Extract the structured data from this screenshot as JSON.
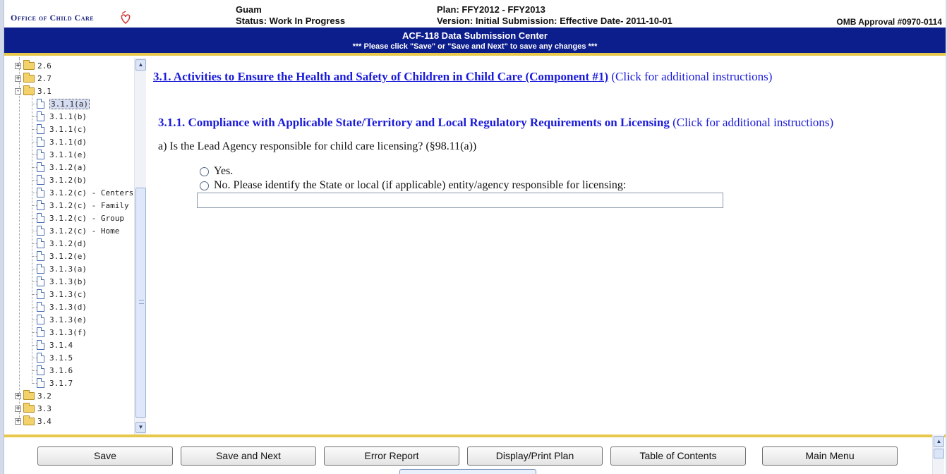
{
  "header": {
    "logo_text": "Office of Child Care",
    "state": "Guam",
    "status": "Status: Work In Progress",
    "plan": "Plan: FFY2012 - FFY2013",
    "version": "Version: Initial Submission: Effective Date- 2011-10-01",
    "omb": "OMB Approval #0970-0114"
  },
  "banner": {
    "title": "ACF-118 Data Submission Center",
    "subtitle": "*** Please click \"Save\" or \"Save and Next\" to save any changes ***"
  },
  "tree": {
    "items": [
      {
        "label": "2.6",
        "type": "folder",
        "expander": "+"
      },
      {
        "label": "2.7",
        "type": "folder",
        "expander": "+"
      },
      {
        "label": "3.1",
        "type": "folder",
        "expander": "-"
      },
      {
        "label": "3.1.1(a)",
        "type": "doc",
        "selected": true
      },
      {
        "label": "3.1.1(b)",
        "type": "doc"
      },
      {
        "label": "3.1.1(c)",
        "type": "doc"
      },
      {
        "label": "3.1.1(d)",
        "type": "doc"
      },
      {
        "label": "3.1.1(e)",
        "type": "doc"
      },
      {
        "label": "3.1.2(a)",
        "type": "doc"
      },
      {
        "label": "3.1.2(b)",
        "type": "doc"
      },
      {
        "label": "3.1.2(c) - Centers",
        "type": "doc"
      },
      {
        "label": "3.1.2(c) - Family",
        "type": "doc"
      },
      {
        "label": "3.1.2(c) - Group",
        "type": "doc"
      },
      {
        "label": "3.1.2(c) - Home",
        "type": "doc"
      },
      {
        "label": "3.1.2(d)",
        "type": "doc"
      },
      {
        "label": "3.1.2(e)",
        "type": "doc"
      },
      {
        "label": "3.1.3(a)",
        "type": "doc"
      },
      {
        "label": "3.1.3(b)",
        "type": "doc"
      },
      {
        "label": "3.1.3(c)",
        "type": "doc"
      },
      {
        "label": "3.1.3(d)",
        "type": "doc"
      },
      {
        "label": "3.1.3(e)",
        "type": "doc"
      },
      {
        "label": "3.1.3(f)",
        "type": "doc"
      },
      {
        "label": "3.1.4",
        "type": "doc"
      },
      {
        "label": "3.1.5",
        "type": "doc"
      },
      {
        "label": "3.1.6",
        "type": "doc"
      },
      {
        "label": "3.1.7",
        "type": "doc"
      },
      {
        "label": "3.2",
        "type": "folder",
        "expander": "+"
      },
      {
        "label": "3.3",
        "type": "folder",
        "expander": "+"
      },
      {
        "label": "3.4",
        "type": "folder",
        "expander": "+"
      }
    ]
  },
  "main": {
    "section_link": "3.1. Activities to Ensure the Health and Safety of Children in Child Care (Component #1)",
    "section_instructions": "(Click for additional instructions)",
    "subsection_title": "3.1.1. Compliance with Applicable State/Territory and Local Regulatory Requirements on Licensing",
    "subsection_instructions": "(Click for additional instructions)",
    "question": "a) Is the Lead Agency responsible for child care licensing? (§98.11(a))",
    "option_yes": "Yes.",
    "option_no": "No. Please identify the State or local (if applicable) entity/agency responsible for licensing:",
    "entity_value": ""
  },
  "footer": {
    "buttons": [
      "Save",
      "Save and Next",
      "Error Report",
      "Display/Print Plan",
      "Table of Contents",
      "Main Menu"
    ]
  },
  "icons": {
    "scroll_up": "scroll-up-arrow-icon",
    "scroll_down": "scroll-down-arrow-icon"
  },
  "colors": {
    "banner": "#0c1d8c",
    "accent_line": "#e8c84a",
    "link": "#1a1adb"
  }
}
